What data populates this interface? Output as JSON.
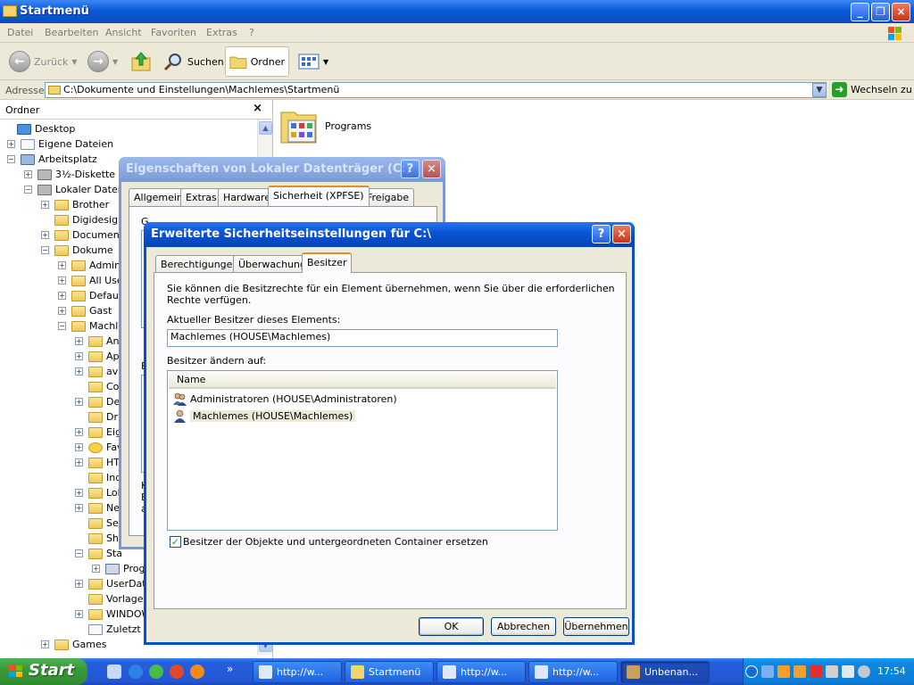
{
  "explorer": {
    "title": "Startmenü",
    "menu": [
      "Datei",
      "Bearbeiten",
      "Ansicht",
      "Favoriten",
      "Extras",
      "?"
    ],
    "toolbar": {
      "back": "Zurück",
      "search": "Suchen",
      "folders": "Ordner"
    },
    "address": {
      "label": "Adresse",
      "value": "C:\\Dokumente und Einstellungen\\Machlemes\\Startmenü",
      "go": "Wechseln zu"
    },
    "pane_title": "Ordner",
    "pane_close": "×",
    "tree": [
      {
        "label": "Desktop"
      },
      {
        "label": "Eigene Dateien"
      },
      {
        "label": "Arbeitsplatz"
      },
      {
        "label": "3½-Diskette (A"
      },
      {
        "label": "Lokaler Datent"
      },
      {
        "label": "Brother"
      },
      {
        "label": "Digidesign"
      },
      {
        "label": "Documents"
      },
      {
        "label": "Dokume"
      },
      {
        "label": "Adminis"
      },
      {
        "label": "All Use"
      },
      {
        "label": "Default"
      },
      {
        "label": "Gast"
      },
      {
        "label": "Machle"
      },
      {
        "label": "An"
      },
      {
        "label": "Ap"
      },
      {
        "label": "avi"
      },
      {
        "label": "Co"
      },
      {
        "label": "De"
      },
      {
        "label": "Dru"
      },
      {
        "label": "Eig"
      },
      {
        "label": "Fav"
      },
      {
        "label": "HT"
      },
      {
        "label": "Ind"
      },
      {
        "label": "Lok"
      },
      {
        "label": "Ne"
      },
      {
        "label": "Sei"
      },
      {
        "label": "Sha"
      },
      {
        "label": "Sta"
      },
      {
        "label": "Progr"
      },
      {
        "label": "UserData"
      },
      {
        "label": "Vorlagen"
      },
      {
        "label": "WINDOW"
      },
      {
        "label": "Zuletzt v"
      },
      {
        "label": "Games"
      }
    ],
    "content_items": [
      "Programs"
    ]
  },
  "dialog_props": {
    "title": "Eigenschaften von Lokaler Datenträger (C:)",
    "help": "?",
    "close": "×",
    "tabs": [
      "Allgemein",
      "Extras",
      "Hardware",
      "Sicherheit (XPFSE)",
      "Freigabe"
    ],
    "partial_text": [
      "G",
      "E",
      "K",
      "E",
      "a"
    ]
  },
  "dialog_adv": {
    "title": "Erweiterte Sicherheitseinstellungen für C:\\",
    "help": "?",
    "close": "×",
    "tabs": [
      "Berechtigungen",
      "Überwachung",
      "Besitzer"
    ],
    "info_text_1": "Sie können die Besitzrechte für ein Element übernehmen, wenn Sie über die erforderlichen",
    "info_text_2": "Rechte verfügen.",
    "current_owner_label": "Aktueller Besitzer dieses Elements:",
    "current_owner_value": "Machlemes (HOUSE\\Machlemes)",
    "change_owner_label": "Besitzer ändern auf:",
    "list_header": "Name",
    "owners": [
      {
        "name": "Administratoren (HOUSE\\Administratoren)",
        "selected": false
      },
      {
        "name": "Machlemes (HOUSE\\Machlemes)",
        "selected": true
      }
    ],
    "replace_checkbox_label": "Besitzer der Objekte und untergeordneten Container ersetzen",
    "replace_checked": true,
    "buttons": {
      "ok": "OK",
      "cancel": "Abbrechen",
      "apply": "Übernehmen"
    }
  },
  "taskbar": {
    "start": "Start",
    "chevron": "»",
    "tasks": [
      {
        "label": "http://w...",
        "active": false
      },
      {
        "label": "Startmenü",
        "active": false
      },
      {
        "label": "http://w...",
        "active": false
      },
      {
        "label": "http://w...",
        "active": false
      },
      {
        "label": "Unbenan...",
        "active": true
      }
    ],
    "clock": "17:54"
  },
  "colors": {
    "title_active": "#0a55d6",
    "title_inactive": "#7a9ad8",
    "tab_highlight": "#e68b2c",
    "taskbar": "#245edc",
    "start": "#3a9a3a"
  }
}
